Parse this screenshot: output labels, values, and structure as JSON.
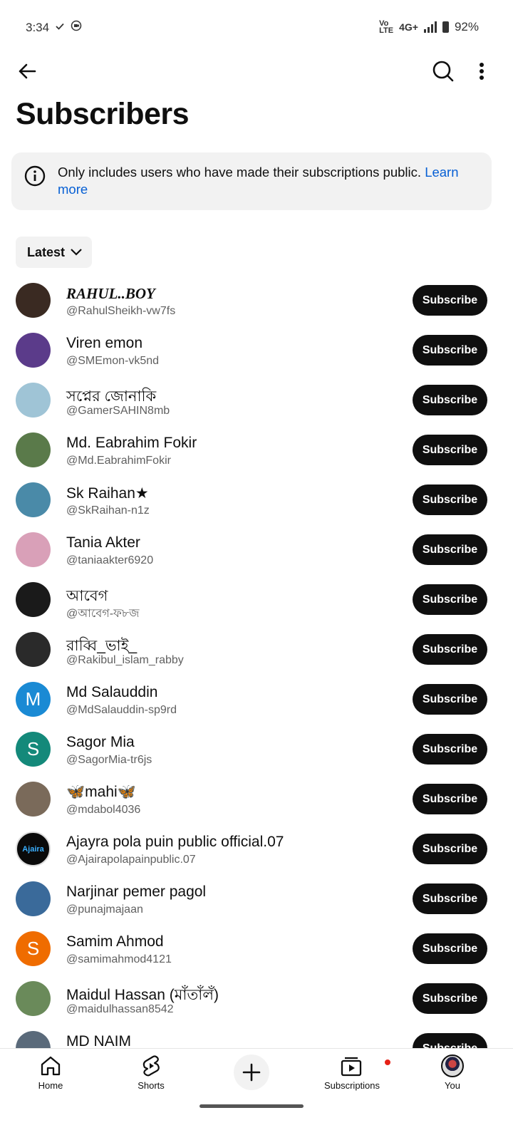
{
  "status_bar": {
    "time": "3:34",
    "network": "4G+",
    "volte": "VoLTE",
    "battery": "92%"
  },
  "header": {
    "title": "Subscribers"
  },
  "info_banner": {
    "text": "Only includes users who have made their subscriptions public.",
    "link": "Learn more"
  },
  "sort": {
    "label": "Latest"
  },
  "subscribe_label": "Subscribe",
  "subscribers": [
    {
      "name": "RAHUL..BOY",
      "handle": "@RahulSheikh-vw7fs",
      "avatar_color": "#3a2a22",
      "initial": ""
    },
    {
      "name": "Viren emon",
      "handle": "@SMEmon-vk5nd",
      "avatar_color": "#5b3b8a",
      "initial": ""
    },
    {
      "name": "সপ্নের জোনাকি",
      "handle": "@GamerSAHIN8mb",
      "avatar_color": "#9fc4d6",
      "initial": ""
    },
    {
      "name": "Md. Eabrahim Fokir",
      "handle": "@Md.EabrahimFokir",
      "avatar_color": "#5a7a4a",
      "initial": ""
    },
    {
      "name": "Sk Raihan★",
      "handle": "@SkRaihan-n1z",
      "avatar_color": "#4a8aa8",
      "initial": ""
    },
    {
      "name": "Tania Akter",
      "handle": "@taniaakter6920",
      "avatar_color": "#d9a0b8",
      "initial": ""
    },
    {
      "name": "আবেগ",
      "handle": "@আবেগ-ফ৮জ",
      "avatar_color": "#1a1a1a",
      "initial": ""
    },
    {
      "name": "রাব্বি_ভাই_",
      "handle": "@Rakibul_islam_rabby",
      "avatar_color": "#2a2a2a",
      "initial": ""
    },
    {
      "name": "Md Salauddin",
      "handle": "@MdSalauddin-sp9rd",
      "avatar_color": "#1a8ad4",
      "initial": "M"
    },
    {
      "name": "Sagor Mia",
      "handle": "@SagorMia-tr6js",
      "avatar_color": "#14897a",
      "initial": "S"
    },
    {
      "name": "🦋mahi🦋",
      "handle": "@mdabol4036",
      "avatar_color": "#7a6a5a",
      "initial": ""
    },
    {
      "name": "Ajayra pola puin  public official.07",
      "handle": "@Ajairapolapainpublic.07",
      "avatar_color": "#0a0a0a",
      "initial": "Ajaira"
    },
    {
      "name": "Narjinar pemer pagol",
      "handle": "@punajmajaan",
      "avatar_color": "#3a6a9a",
      "initial": ""
    },
    {
      "name": "Samim Ahmod",
      "handle": "@samimahmod4121",
      "avatar_color": "#ef6c00",
      "initial": "S"
    },
    {
      "name": "Maidul Hassan (মাঁতাঁলঁ)",
      "handle": "@maidulhassan8542",
      "avatar_color": "#6a8a5a",
      "initial": ""
    },
    {
      "name": "MD NAIM",
      "handle": "",
      "avatar_color": "#5a6a7a",
      "initial": ""
    }
  ],
  "bottom_nav": {
    "home": "Home",
    "shorts": "Shorts",
    "subscriptions": "Subscriptions",
    "you": "You"
  },
  "colors": {
    "accent_link": "#065fd4",
    "button_bg": "#0f0f0f",
    "notification": "#e62117"
  }
}
